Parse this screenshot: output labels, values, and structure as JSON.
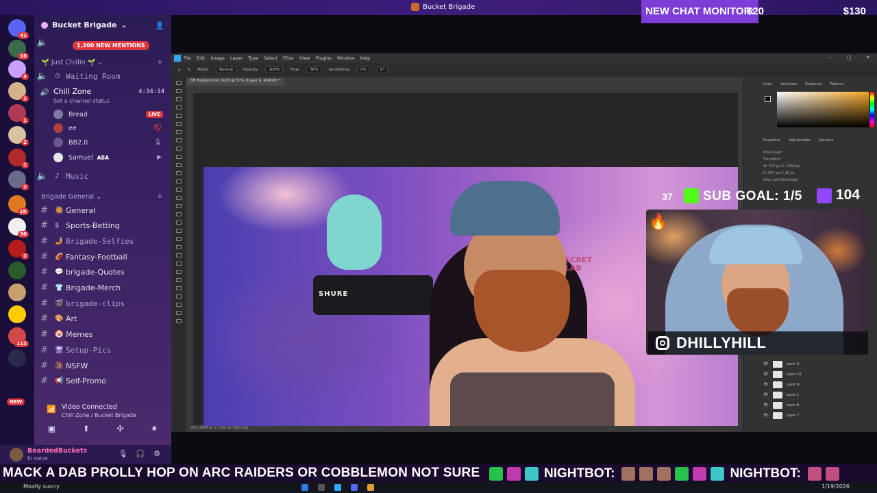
{
  "window": {
    "title": "Bucket Brigade"
  },
  "chat_monitor": {
    "label": "NEW CHAT MONITOR:",
    "amount1": "$20",
    "amount2": "$130"
  },
  "rail": {
    "servers": [
      {
        "badge": "41",
        "color": "#5865f2"
      },
      {
        "badge": "16",
        "color": "#3a6b4a"
      },
      {
        "badge": "4",
        "color": "#c9a0ff"
      },
      {
        "badge": "1",
        "color": "#d6b28a"
      },
      {
        "badge": "1",
        "color": "#b03a55"
      },
      {
        "badge": "2",
        "color": "#d8c4a0"
      },
      {
        "badge": "1",
        "color": "#b02a2a"
      },
      {
        "badge": "2",
        "color": "#6a6a8a"
      },
      {
        "badge": "1K",
        "color": "#e07a20"
      },
      {
        "badge": "30",
        "color": "#f0f0f0"
      },
      {
        "badge": "2",
        "color": "#b81d1d"
      },
      {
        "badge": "",
        "color": "#2a5c2a"
      },
      {
        "badge": "",
        "color": "#c8a070"
      },
      {
        "badge": "",
        "color": "#ffcc00"
      },
      {
        "badge": "113",
        "color": "#d04848"
      },
      {
        "badge": "",
        "color": "#2a2a4a"
      }
    ],
    "new_label": "NEW"
  },
  "discord": {
    "server_name": "Bucket Brigade",
    "mentions": "1,200 NEW MENTIONS",
    "categories": {
      "chill": "Just Chillin",
      "general": "Brigade General"
    },
    "waiting_room": "Waiting Room",
    "chill_zone": {
      "name": "Chill Zone",
      "time": "4:34:14",
      "status": "Set a channel status"
    },
    "users": [
      {
        "name": "Bread",
        "live": "LIVE"
      },
      {
        "name": "ее"
      },
      {
        "name": "BB2.0"
      },
      {
        "name": "Samuel",
        "tag": "ABA"
      }
    ],
    "music": "Music",
    "channels": [
      {
        "name": "General",
        "icon": "🥘"
      },
      {
        "name": "Sports-Betting",
        "icon": "$"
      },
      {
        "name": "Brigade-Selfies",
        "icon": "🤳"
      },
      {
        "name": "Fantasy-Football",
        "icon": "🏈"
      },
      {
        "name": "brigade-Quotes",
        "icon": "💬"
      },
      {
        "name": "Brigade-Merch",
        "icon": "👕"
      },
      {
        "name": "brigade-clips",
        "icon": "🎬"
      },
      {
        "name": "Art",
        "icon": "🎨"
      },
      {
        "name": "Memes",
        "icon": "🤡"
      },
      {
        "name": "Setup-Pics",
        "icon": "🖥"
      },
      {
        "name": "NSFW",
        "icon": "🔞"
      },
      {
        "name": "Self-Promo",
        "icon": "📢"
      }
    ],
    "voice": {
      "title": "Video Connected",
      "sub": "Chill Zone / Bucket Brigade"
    },
    "me": {
      "name": "BeardedBuckets",
      "status": "In voice"
    }
  },
  "photoshop": {
    "menu": [
      "File",
      "Edit",
      "Image",
      "Layer",
      "Type",
      "Select",
      "Filter",
      "View",
      "Plugins",
      "Window",
      "Help"
    ],
    "options": {
      "mode_label": "Mode:",
      "mode": "Normal",
      "opacity_label": "Opacity:",
      "opacity": "100%",
      "flow_label": "Flow:",
      "flow": "38%",
      "smoothing_label": "Smoothing:",
      "smoothing": "0%",
      "angle": "0°"
    },
    "doc_tab": "BB Background 2k26 @ 50% (Layer 6, RGB/8) *",
    "status": "50%      3840 px x 2160 px (300 ppi)",
    "panel_tabs": [
      "Color",
      "Swatches",
      "Gradients",
      "Patterns"
    ],
    "prop_tabs": [
      "Properties",
      "Adjustments",
      "Libraries"
    ],
    "props": [
      "Pixel Layer",
      "Transform",
      "W: 713 px   X: 1260 px",
      "H: 587 px   Y: 20 px",
      "Align and Distribute"
    ],
    "layers": [
      "Layer 3",
      "Layer 10",
      "Layer 9",
      "Layer 1",
      "Layer 8",
      "Layer 7"
    ]
  },
  "photo": {
    "mic_brand": "SHURE",
    "chair_text": "ECRET\nLAB"
  },
  "overlay": {
    "sub_count": "37",
    "sub_goal": "SUB GOAL: 1/5",
    "twitch_count": "104",
    "instagram": "DHILLYHILL"
  },
  "ticker": {
    "message": "MACK A DAB PROLLY HOP ON ARC RAIDERS OR COBBLEMON NOT SURE",
    "bot1": "NIGHTBOT:",
    "bot2": "NIGHTBOT:"
  },
  "taskbar": {
    "weather": "Mostly sunny",
    "date": "1/19/2026"
  },
  "colors": {
    "accent": "#7c3ed7",
    "live": "#e0373f",
    "kick": "#53fc18",
    "twitch": "#9146ff"
  }
}
